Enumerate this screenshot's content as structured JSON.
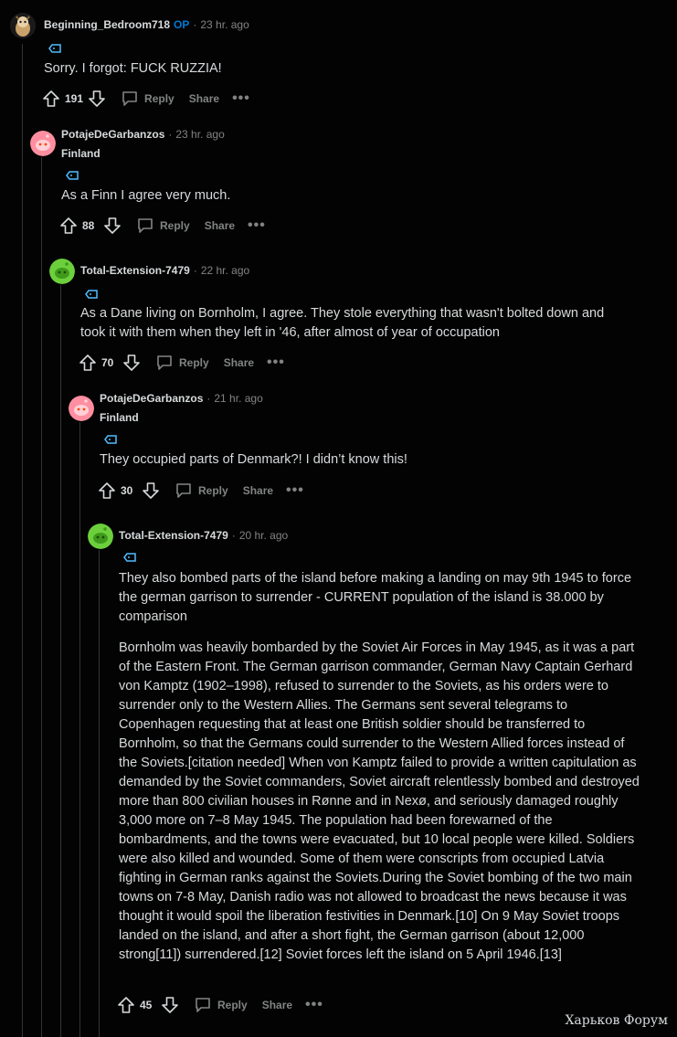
{
  "comments": [
    {
      "author": "Beginning_Bedroom718",
      "op_badge": "OP",
      "sep": "·",
      "time": "23 hr. ago",
      "flair": "",
      "paragraphs": [
        "Sorry. I forgot: FUCK RUZZIA!"
      ],
      "score": "191",
      "reply_label": "Reply",
      "share_label": "Share",
      "more_label": "•••",
      "avatar_color": "#c9a26a"
    },
    {
      "author": "PotajeDeGarbanzos",
      "sep": "·",
      "time": "23 hr. ago",
      "flair": "Finland",
      "paragraphs": [
        "As a Finn I agree very much."
      ],
      "score": "88",
      "reply_label": "Reply",
      "share_label": "Share",
      "more_label": "•••",
      "avatar_color": "#ff8fa0"
    },
    {
      "author": "Total-Extension-7479",
      "sep": "·",
      "time": "22 hr. ago",
      "flair": "",
      "paragraphs": [
        "As a Dane living on Bornholm, I agree. They stole everything that wasn't bolted down and took it with them when they left in '46, after almost of year of occupation"
      ],
      "score": "70",
      "reply_label": "Reply",
      "share_label": "Share",
      "more_label": "•••",
      "avatar_color": "#6cd03c"
    },
    {
      "author": "PotajeDeGarbanzos",
      "sep": "·",
      "time": "21 hr. ago",
      "flair": "Finland",
      "paragraphs": [
        "They occupied parts of Denmark?! I didn’t know this!"
      ],
      "score": "30",
      "reply_label": "Reply",
      "share_label": "Share",
      "more_label": "•••",
      "avatar_color": "#ff8fa0"
    },
    {
      "author": "Total-Extension-7479",
      "sep": "·",
      "time": "20 hr. ago",
      "flair": "",
      "paragraphs": [
        "They also bombed parts of the island before making a landing on may 9th 1945 to force the german garrison to surrender - CURRENT population of the island is 38.000 by comparison",
        "Bornholm was heavily bombarded by the Soviet Air Forces in May 1945, as it was a part of the Eastern Front. The German garrison commander, German Navy Captain Gerhard von Kamptz (1902–1998), refused to surrender to the Soviets, as his orders were to surrender only to the Western Allies. The Germans sent several telegrams to Copenhagen requesting that at least one British soldier should be transferred to Bornholm, so that the Germans could surrender to the Western Allied forces instead of the Soviets.[citation needed] When von Kamptz failed to provide a written capitulation as demanded by the Soviet commanders, Soviet aircraft relentlessly bombed and destroyed more than 800 civilian houses in Rønne and in Nexø, and seriously damaged roughly 3,000 more on 7–8 May 1945. The population had been forewarned of the bombardments, and the towns were evacuated, but 10 local people were killed. Soldiers were also killed and wounded. Some of them were conscripts from occupied Latvia fighting in German ranks against the Soviets.During the Soviet bombing of the two main towns on 7-8 May, Danish radio was not allowed to broadcast the news because it was thought it would spoil the liberation festivities in Denmark.[10] On 9 May Soviet troops landed on the island, and after a short fight, the German garrison (about 12,000 strong[11]) surrendered.[12] Soviet forces left the island on 5 April 1946.[13]"
      ],
      "score": "45",
      "reply_label": "Reply",
      "share_label": "Share",
      "more_label": "•••",
      "avatar_color": "#6cd03c"
    }
  ],
  "watermark": "Харьков Форум",
  "icons": {
    "award": "award-icon",
    "upvote": "upvote-icon",
    "downvote": "downvote-icon",
    "reply": "reply-icon",
    "snoo": "snoo-avatar-icon"
  }
}
